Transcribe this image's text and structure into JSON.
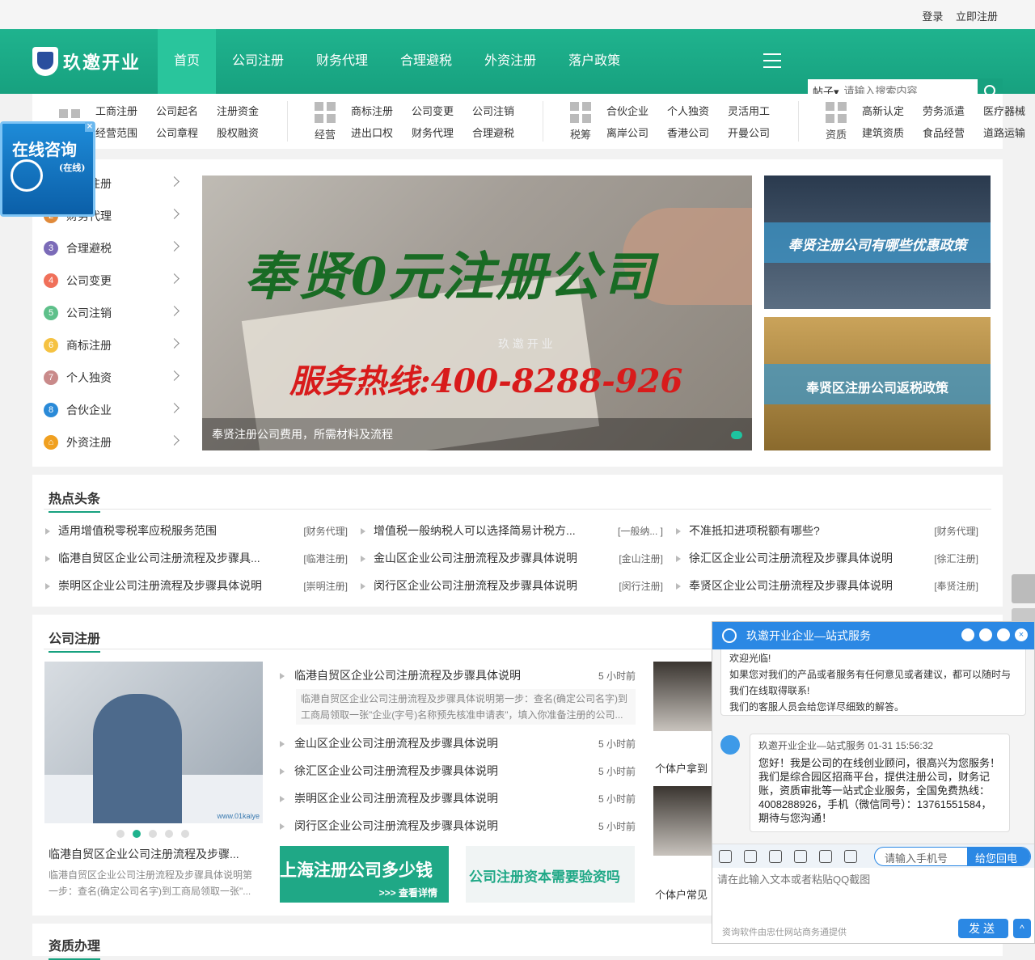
{
  "topbar": {
    "login": "登录",
    "register": "立即注册"
  },
  "logo": {
    "text": "玖邀开业"
  },
  "nav": {
    "items": [
      "首页",
      "公司注册",
      "财务代理",
      "合理避税",
      "外资注册",
      "落户政策"
    ],
    "active": 0
  },
  "search": {
    "select": "帖子▾",
    "placeholder": "请输入搜索内容"
  },
  "subnav": [
    {
      "label": "",
      "items": [
        "工商注册",
        "公司起名",
        "注册资金",
        "经营范围",
        "公司章程",
        "股权融资"
      ]
    },
    {
      "label": "经营",
      "items": [
        "商标注册",
        "公司变更",
        "公司注销",
        "进出口权",
        "财务代理",
        "合理避税"
      ]
    },
    {
      "label": "税筹",
      "items": [
        "合伙企业",
        "个人独资",
        "灵活用工",
        "离岸公司",
        "香港公司",
        "开曼公司"
      ]
    },
    {
      "label": "资质",
      "items": [
        "高新认定",
        "劳务派遣",
        "医疗器械",
        "建筑资质",
        "食品经营",
        "道路运输"
      ]
    }
  ],
  "float_consult": {
    "title": "在线咨询",
    "sub": "(在线)",
    "close": "×"
  },
  "categories": [
    {
      "n": "1",
      "label": "公司注册",
      "color": "#3a8fe0"
    },
    {
      "n": "2",
      "label": "财务代理",
      "color": "#e08a3a"
    },
    {
      "n": "3",
      "label": "合理避税",
      "color": "#7b6bb8"
    },
    {
      "n": "4",
      "label": "公司变更",
      "color": "#f0705a"
    },
    {
      "n": "5",
      "label": "公司注销",
      "color": "#5ec08a"
    },
    {
      "n": "6",
      "label": "商标注册",
      "color": "#f5c242"
    },
    {
      "n": "7",
      "label": "个人独资",
      "color": "#c98a8a"
    },
    {
      "n": "8",
      "label": "合伙企业",
      "color": "#2a8ad8"
    },
    {
      "n": "⌂",
      "label": "外资注册",
      "color": "#f0a020"
    }
  ],
  "banner": {
    "headline": "奉贤0元注册公司",
    "hotline": "服务热线:400-8288-926",
    "watermark": "玖 邀 开 业",
    "caption": "奉贤注册公司费用，所需材料及流程"
  },
  "side_banners": [
    "奉贤注册公司有哪些优惠政策",
    "奉贤区注册公司返税政策"
  ],
  "hot": {
    "title": "热点头条",
    "items": [
      {
        "t": "适用增值税零税率应税服务范围",
        "tag": "[财务代理]"
      },
      {
        "t": "增值税一般纳税人可以选择简易计税方...",
        "tag": "[一般纳... ]"
      },
      {
        "t": "不准抵扣进项税额有哪些?",
        "tag": "[财务代理]"
      },
      {
        "t": "临港自贸区企业公司注册流程及步骤具...",
        "tag": "[临港注册]"
      },
      {
        "t": "金山区企业公司注册流程及步骤具体说明",
        "tag": "[金山注册]"
      },
      {
        "t": "徐汇区企业公司注册流程及步骤具体说明",
        "tag": "[徐汇注册]"
      },
      {
        "t": "崇明区企业公司注册流程及步骤具体说明",
        "tag": "[崇明注册]"
      },
      {
        "t": "闵行区企业公司注册流程及步骤具体说明",
        "tag": "[闵行注册]"
      },
      {
        "t": "奉贤区企业公司注册流程及步骤具体说明",
        "tag": "[奉贤注册]"
      }
    ]
  },
  "reg": {
    "title": "公司注册",
    "feature_caption": "临港自贸区企业公司注册流程及步骤...",
    "feature_desc": "临港自贸区企业公司注册流程及步骤具体说明第一步：查名(确定公司名字)到工商局领取一张\"...",
    "img_watermark": "www.01kaiye",
    "list": [
      {
        "t": "临港自贸区企业公司注册流程及步骤具体说明",
        "tm": "5 小时前",
        "desc": "临港自贸区企业公司注册流程及步骤具体说明第一步：查名(确定公司名字)到工商局领取一张\"企业(字号)名称预先核准申请表\"，填入你准备注册的公司..."
      },
      {
        "t": "金山区企业公司注册流程及步骤具体说明",
        "tm": "5 小时前"
      },
      {
        "t": "徐汇区企业公司注册流程及步骤具体说明",
        "tm": "5 小时前"
      },
      {
        "t": "崇明区企业公司注册流程及步骤具体说明",
        "tm": "5 小时前"
      },
      {
        "t": "闵行区企业公司注册流程及步骤具体说明",
        "tm": "5 小时前"
      }
    ],
    "ad1_title": "上海注册公司多少钱",
    "ad1_sub": ">>> 查看详情",
    "ad2_title": "公司注册资本需要验资吗",
    "thumbs": [
      "个体户拿到",
      "个体户常见"
    ]
  },
  "zizhi": {
    "title": "资质办理"
  },
  "chat": {
    "title": "玖邀开业企业—站式服务",
    "welcome": [
      "欢迎光临!",
      "如果您对我们的产品或者服务有任何意见或者建议，都可以随时与",
      "我们在线取得联系!",
      "我们的客服人员会给您详尽细致的解答。"
    ],
    "meta": "玖邀开业企业—站式服务  01-31 15:56:32",
    "msg": "您好！我是公司的在线创业顾问，很高兴为您服务！我们是综合园区招商平台，提供注册公司，财务记账，资质审批等一站式企业服务，全国免费热线：4008288926，手机（微信同号）：13761551584，期待与您沟通！",
    "phone_placeholder": "请输入手机号码",
    "callback": "给您回电",
    "input_placeholder": "请在此输入文本或者粘贴QQ截图",
    "footer": "资询软件由忠仕网站商务通提供",
    "send": "发送",
    "up": "^"
  }
}
